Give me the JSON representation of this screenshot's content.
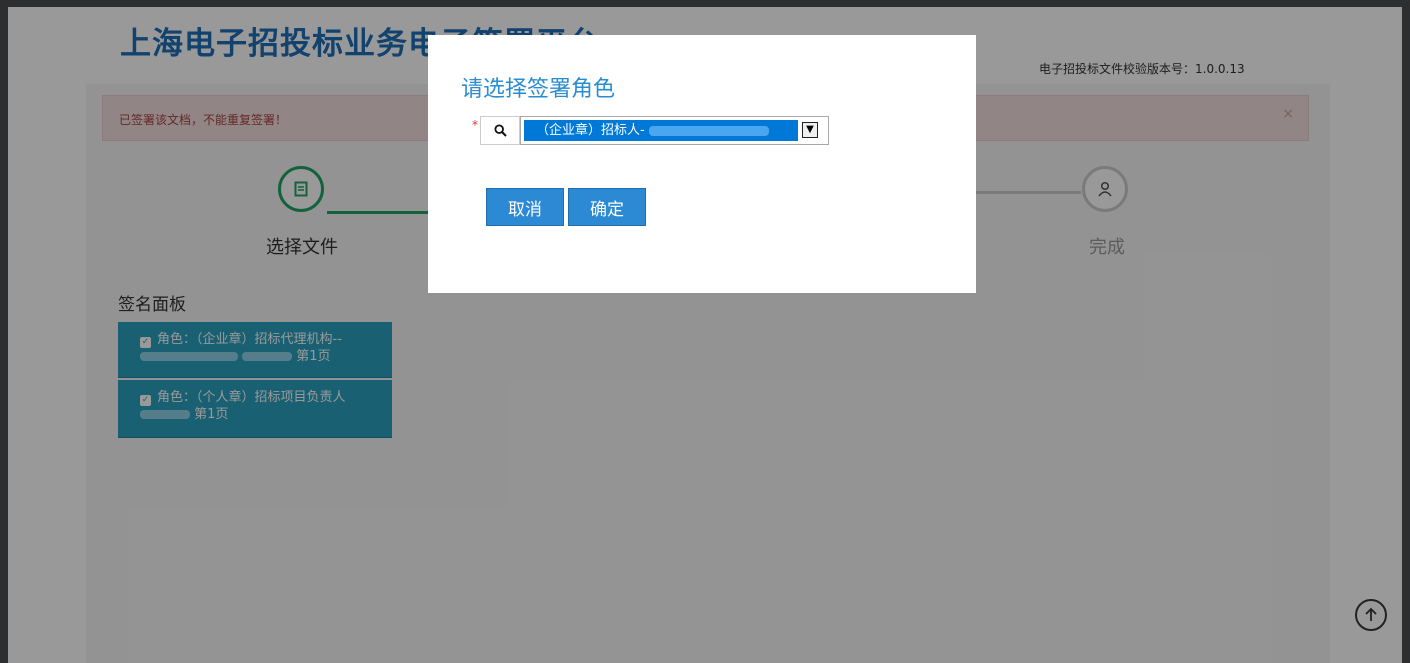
{
  "header": {
    "title": "上海电子招投标业务电子签署平台",
    "version_text": "电子招投标文件校验版本号：1.0.0.13"
  },
  "alert": {
    "message": "已签署该文档，不能重复签署！",
    "close": "×"
  },
  "steps": [
    {
      "label": "选择文件",
      "icon": "document-icon",
      "status": "completed"
    },
    {
      "label": "完成",
      "icon": "user-icon",
      "status": "pending"
    }
  ],
  "signature_panel": {
    "title": "签名面板",
    "items": [
      {
        "line1": "角色：（企业章）招标代理机构--",
        "page": "第1页"
      },
      {
        "line1": "角色：（个人章）招标项目负责人",
        "page": "第1页"
      }
    ]
  },
  "modal": {
    "title": "请选择签署角色",
    "required_mark": "*",
    "role_select_value": "（企业章）招标人-",
    "cancel_label": "取消",
    "confirm_label": "确定"
  },
  "colors": {
    "brand": "#1f6fb8",
    "step_active": "#21a366",
    "panel_item": "#2aa0c0",
    "button": "#2c8ad4",
    "alert_bg": "#f2dede",
    "alert_text": "#a94442"
  }
}
